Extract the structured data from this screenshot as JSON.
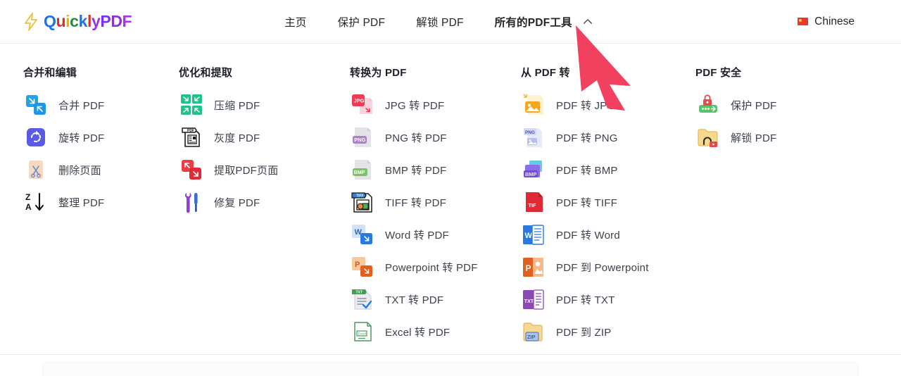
{
  "header": {
    "logo": {
      "icon": "lightning-bolt-icon",
      "letters": [
        {
          "ch": "Q",
          "color": "#1a73e8"
        },
        {
          "ch": "u",
          "color": "#d93025"
        },
        {
          "ch": "i",
          "color": "#f9ab00"
        },
        {
          "ch": "c",
          "color": "#1e8e3e"
        },
        {
          "ch": "k",
          "color": "#1a73e8"
        },
        {
          "ch": "l",
          "color": "#d93025"
        },
        {
          "ch": "y",
          "color": "#9334e6"
        },
        {
          "ch": "P",
          "color": "#7b2ff7"
        },
        {
          "ch": "D",
          "color": "#8e2de2"
        },
        {
          "ch": "F",
          "color": "#a733f0"
        }
      ]
    },
    "nav": [
      {
        "label": "主页",
        "active": false
      },
      {
        "label": "保护 PDF",
        "active": false
      },
      {
        "label": "解锁 PDF",
        "active": false
      },
      {
        "label": "所有的PDF工具",
        "active": true
      }
    ],
    "chevron_icon": "chevron-up-icon",
    "language": {
      "label": "Chinese",
      "flag_icon": "china-flag-icon",
      "flag_color": "#e8392b"
    }
  },
  "annotation": {
    "type": "arrow-pointer",
    "color": "#f2405f",
    "points_to": "所有的PDF工具"
  },
  "mega_menu": {
    "columns": [
      {
        "title": "合并和编辑",
        "items": [
          {
            "label": "合并 PDF",
            "icon": "merge-pdf-icon"
          },
          {
            "label": "旋转 PDF",
            "icon": "rotate-pdf-icon"
          },
          {
            "label": "删除页面",
            "icon": "delete-pages-icon"
          },
          {
            "label": "整理 PDF",
            "icon": "sort-pdf-icon"
          }
        ]
      },
      {
        "title": "优化和提取",
        "items": [
          {
            "label": "压缩 PDF",
            "icon": "compress-pdf-icon"
          },
          {
            "label": "灰度 PDF",
            "icon": "grayscale-pdf-icon"
          },
          {
            "label": "提取PDF页面",
            "icon": "extract-pages-icon"
          },
          {
            "label": "修复 PDF",
            "icon": "repair-pdf-icon"
          }
        ]
      },
      {
        "title": "转换为 PDF",
        "items": [
          {
            "label": "JPG 转 PDF",
            "icon": "jpg-to-pdf-icon"
          },
          {
            "label": "PNG 转 PDF",
            "icon": "png-to-pdf-icon"
          },
          {
            "label": "BMP 转 PDF",
            "icon": "bmp-to-pdf-icon"
          },
          {
            "label": "TIFF 转 PDF",
            "icon": "tiff-to-pdf-icon"
          },
          {
            "label": "Word 转 PDF",
            "icon": "word-to-pdf-icon"
          },
          {
            "label": "Powerpoint 转 PDF",
            "icon": "powerpoint-to-pdf-icon"
          },
          {
            "label": "TXT 转 PDF",
            "icon": "txt-to-pdf-icon"
          },
          {
            "label": "Excel 转 PDF",
            "icon": "excel-to-pdf-icon"
          }
        ]
      },
      {
        "title": "从 PDF 转",
        "items": [
          {
            "label": "PDF 转 JPG",
            "icon": "pdf-to-jpg-icon"
          },
          {
            "label": "PDF 转 PNG",
            "icon": "pdf-to-png-icon"
          },
          {
            "label": "PDF 转 BMP",
            "icon": "pdf-to-bmp-icon"
          },
          {
            "label": "PDF 转 TIFF",
            "icon": "pdf-to-tiff-icon"
          },
          {
            "label": "PDF 转 Word",
            "icon": "pdf-to-word-icon"
          },
          {
            "label": "PDF 到 Powerpoint",
            "icon": "pdf-to-powerpoint-icon"
          },
          {
            "label": "PDF 转 TXT",
            "icon": "pdf-to-txt-icon"
          },
          {
            "label": "PDF 到 ZIP",
            "icon": "pdf-to-zip-icon"
          }
        ]
      },
      {
        "title": "PDF 安全",
        "items": [
          {
            "label": "保护 PDF",
            "icon": "protect-pdf-icon"
          },
          {
            "label": "解锁 PDF",
            "icon": "unlock-pdf-icon"
          }
        ]
      }
    ]
  }
}
